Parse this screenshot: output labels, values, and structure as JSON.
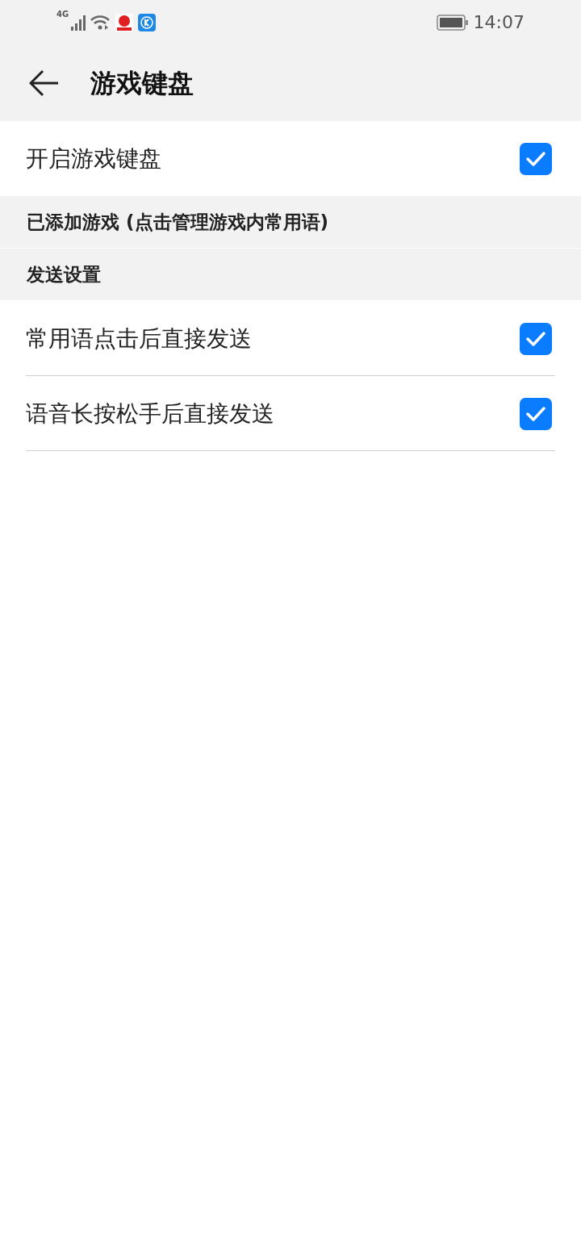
{
  "status_bar": {
    "network": "4G",
    "time": "14:07"
  },
  "header": {
    "title": "游戏键盘"
  },
  "items": [
    {
      "kind": "toggle",
      "label": "开启游戏键盘",
      "checked": true,
      "divider": false
    },
    {
      "kind": "section",
      "label": "已添加游戏 (点击管理游戏内常用语)"
    },
    {
      "kind": "section",
      "label": "发送设置"
    },
    {
      "kind": "toggle",
      "label": "常用语点击后直接发送",
      "checked": true,
      "divider": true
    },
    {
      "kind": "toggle",
      "label": "语音长按松手后直接发送",
      "checked": true,
      "divider": true
    }
  ]
}
